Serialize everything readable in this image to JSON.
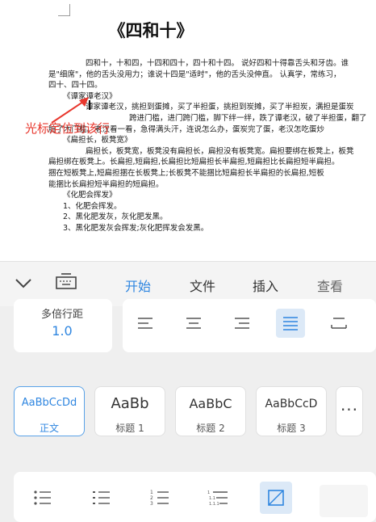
{
  "document": {
    "title": "《四和十》",
    "lines": [
      "四和十，十和四，十四和四十，四十和十四。 说好四和十得靠舌头和牙齿。谁",
      "是\"细席\"，他的舌头没用力；谁说十四是\"适时\"，他的舌头没伸直。 认真学，常练习，",
      "四十、四十四。",
      "《谭家谭老汉》",
      "谭家谭老汉，挑担到蛋摊，买了半担蛋，挑担到炭摊，买了半担炭，满担是蛋炭",
      "跨进门槛，进门跨门槛，脚下绊一绊，跌了谭老汉，破了半担蛋，翻了",
      "脏了木门槛。老汉看一看，急得满头汗，连说怎么办，蛋炭完了蛋，老汉怎吃蛋炒",
      "《扁担长，板凳宽》",
      "扁担长，板凳宽，板凳没有扁担长，扁担没有板凳宽。扁担要绑在板凳上，板凳",
      "扁担绑在板凳上。长扁担,短扁担,长扁担比短扁担长半扁担,短扁担比长扁担短半扁担。",
      "捆在短板凳上,短扁担捆在长板凳上;长板凳不能捆比短扁担长半扁担的长扁担,短板",
      "能捆比长扁担短半扁担的短扁担。",
      "《化肥会挥发》",
      "1、化肥会挥发。",
      "2、黑化肥发灰，灰化肥发黑。",
      "3、黑化肥发灰会挥发;灰化肥挥发会发黑。"
    ],
    "annotation": "光标定位到该行"
  },
  "toolbar": {
    "tabs": [
      {
        "label": "开始",
        "active": true
      },
      {
        "label": "文件",
        "active": false
      },
      {
        "label": "插入",
        "active": false
      },
      {
        "label": "查看",
        "active": false
      }
    ],
    "icons": [
      "chevron-down-icon",
      "keyboard-icon"
    ]
  },
  "paragraph": {
    "spacing_label": "多倍行距",
    "spacing_value": "1.0",
    "alignments": [
      "align-left",
      "align-center",
      "align-right",
      "align-justify",
      "align-distributed"
    ],
    "selected_alignment": "align-justify"
  },
  "styles": [
    {
      "sample": "AaBbCcDd",
      "name": "正文",
      "selected": true
    },
    {
      "sample": "AaBb",
      "name": "标题 1",
      "selected": false
    },
    {
      "sample": "AaBbC",
      "name": "标题 2",
      "selected": false
    },
    {
      "sample": "AaBbCcD",
      "name": "标题 3",
      "selected": false
    }
  ],
  "more_label": "···",
  "list_tools": [
    "bullet-list-icon",
    "dash-list-icon",
    "numbered-list-icon",
    "multilevel-list-icon",
    "border-icon"
  ],
  "colors": {
    "accent": "#2f86e0",
    "annotation": "#e8372d",
    "panel": "#efefef",
    "selected_bg": "#dce9f7"
  }
}
